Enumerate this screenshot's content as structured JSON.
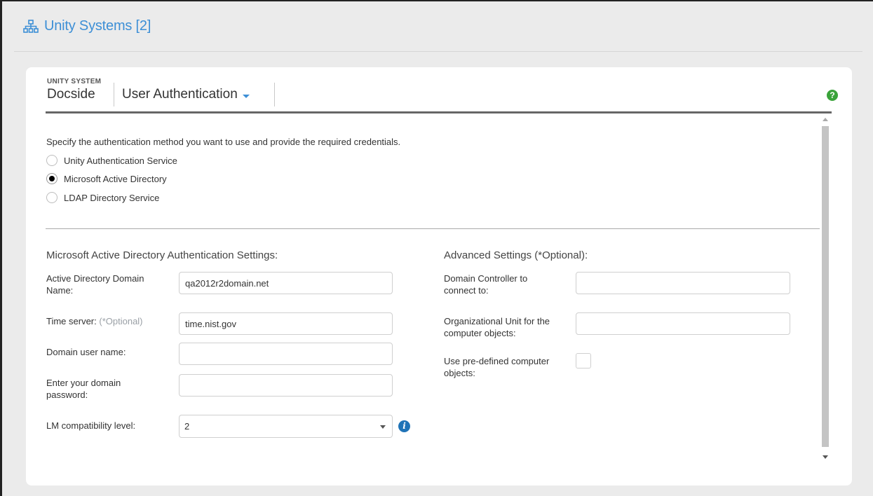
{
  "header": {
    "title": "Unity Systems [2]",
    "icon": "network-hierarchy-icon",
    "accent_color": "#3d8fd6"
  },
  "card": {
    "system_caption": "UNITY SYSTEM",
    "system_name": "Docside",
    "section_label": "User Authentication",
    "help_icon_label": "?"
  },
  "auth": {
    "intro": "Specify the authentication method you want to use and provide the required credentials.",
    "options": [
      {
        "label": "Unity Authentication Service",
        "selected": false
      },
      {
        "label": "Microsoft Active Directory",
        "selected": true
      },
      {
        "label": "LDAP Directory Service",
        "selected": false
      }
    ]
  },
  "ms_settings": {
    "title": "Microsoft Active Directory Authentication Settings:",
    "domain_name_label": "Active Directory Domain Name:",
    "domain_name_value": "qa2012r2domain.net",
    "time_server_label": "Time server:",
    "time_server_optional": "(*Optional)",
    "time_server_value": "time.nist.gov",
    "user_name_label": "Domain user name:",
    "user_name_value": "",
    "password_label": "Enter your domain password:",
    "password_value": "",
    "lm_label": "LM compatibility level:",
    "lm_value": "2",
    "info_icon_label": "i"
  },
  "advanced": {
    "title": "Advanced Settings (*Optional):",
    "dc_label": "Domain Controller to connect to:",
    "dc_value": "",
    "ou_label": "Organizational Unit for the computer objects:",
    "ou_value": "",
    "predefined_label": "Use pre-defined computer objects:",
    "predefined_checked": false
  }
}
